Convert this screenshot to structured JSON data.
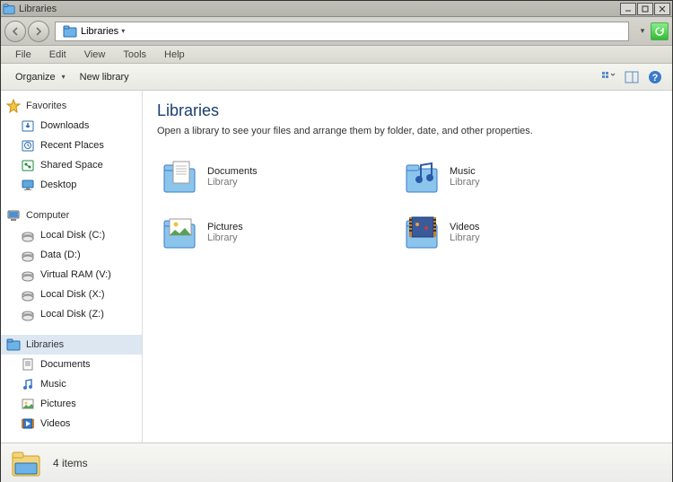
{
  "window": {
    "title": "Libraries"
  },
  "breadcrumb": {
    "label": "Libraries"
  },
  "menubar": [
    "File",
    "Edit",
    "View",
    "Tools",
    "Help"
  ],
  "toolbar": {
    "organize": "Organize",
    "new_library": "New library"
  },
  "sidebar": {
    "favorites": {
      "label": "Favorites",
      "items": [
        {
          "label": "Downloads",
          "icon": "download"
        },
        {
          "label": "Recent Places",
          "icon": "recent"
        },
        {
          "label": "Shared Space",
          "icon": "shared"
        },
        {
          "label": "Desktop",
          "icon": "desktop"
        }
      ]
    },
    "computer": {
      "label": "Computer",
      "items": [
        {
          "label": "Local Disk (C:)"
        },
        {
          "label": "Data (D:)"
        },
        {
          "label": "Virtual RAM (V:)"
        },
        {
          "label": "Local Disk (X:)"
        },
        {
          "label": "Local Disk (Z:)"
        }
      ]
    },
    "libraries": {
      "label": "Libraries",
      "items": [
        {
          "label": "Documents",
          "icon": "documents"
        },
        {
          "label": "Music",
          "icon": "music"
        },
        {
          "label": "Pictures",
          "icon": "pictures"
        },
        {
          "label": "Videos",
          "icon": "videos"
        }
      ]
    }
  },
  "main": {
    "heading": "Libraries",
    "subtitle": "Open a library to see your files and arrange them by folder, date, and other properties.",
    "tiles": [
      {
        "name": "Documents",
        "type": "Library",
        "icon": "documents"
      },
      {
        "name": "Music",
        "type": "Library",
        "icon": "music"
      },
      {
        "name": "Pictures",
        "type": "Library",
        "icon": "pictures"
      },
      {
        "name": "Videos",
        "type": "Library",
        "icon": "videos"
      }
    ]
  },
  "status": {
    "count": "4 items"
  }
}
